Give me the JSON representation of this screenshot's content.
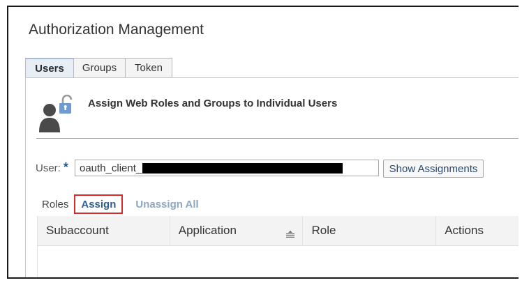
{
  "app": {
    "title": "Authorization Management"
  },
  "tabs": [
    {
      "label": "Users",
      "active": true
    },
    {
      "label": "Groups",
      "active": false
    },
    {
      "label": "Token",
      "active": false
    }
  ],
  "panel": {
    "icon": "user-lock-icon",
    "title": "Assign Web Roles and Groups to Individual Users"
  },
  "user_field": {
    "label": "User:",
    "required_marker": "*",
    "value": "oauth_client_",
    "action_label": "Show Assignments"
  },
  "roles_toolbar": {
    "label": "Roles",
    "assign_label": "Assign",
    "unassign_all_label": "Unassign All"
  },
  "table": {
    "columns": [
      "Subaccount",
      "Application",
      "Role",
      "Actions"
    ],
    "rows": []
  },
  "colors": {
    "accent": "#315f8f",
    "highlight_border": "#d62b2b",
    "disabled_link": "#8ea7c0",
    "lock_icon": "#6d9bd1"
  }
}
